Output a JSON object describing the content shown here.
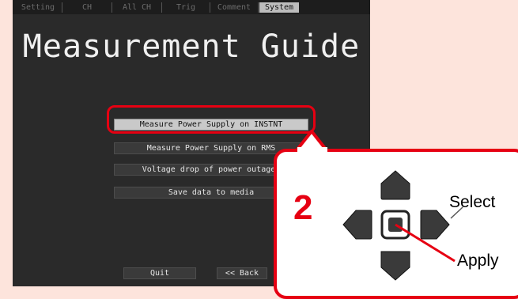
{
  "tabs": [
    {
      "label": "Setting",
      "active": false
    },
    {
      "label": "CH",
      "active": false
    },
    {
      "label": "All CH",
      "active": false
    },
    {
      "label": "Trig",
      "active": false
    },
    {
      "label": "Comment",
      "active": false
    },
    {
      "label": "System",
      "active": true
    }
  ],
  "screen": {
    "title": "Measurement Guide",
    "menu": [
      {
        "label": "Measure Power Supply on INSTNT",
        "selected": true
      },
      {
        "label": "Measure Power Supply on RMS",
        "selected": false
      },
      {
        "label": "Voltage drop of power outage.",
        "selected": false
      },
      {
        "label": "Save data to media",
        "selected": false
      }
    ],
    "quit_label": "Quit",
    "back_label": "<< Back"
  },
  "callout": {
    "step": "2",
    "select_label": "Select",
    "apply_label": "Apply",
    "keys": [
      "up-arrow-icon",
      "left-arrow-icon",
      "center-enter-icon",
      "right-arrow-icon",
      "down-arrow-icon"
    ]
  },
  "colors": {
    "highlight": "#e60012",
    "screen_bg": "#2a2a2a",
    "page_bg": "#fde4dc",
    "key_fill": "#3a3a3a"
  }
}
